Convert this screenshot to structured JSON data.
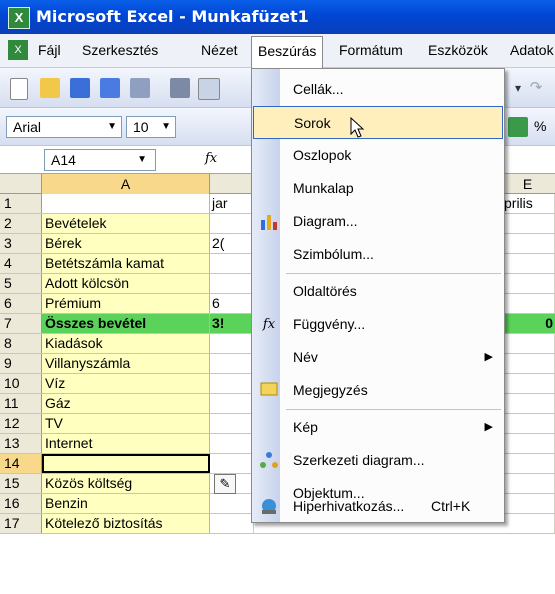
{
  "window": {
    "title": "Microsoft Excel - Munkafüzet1"
  },
  "menubar": {
    "items": [
      {
        "label": "Fájl"
      },
      {
        "label": "Szerkesztés"
      },
      {
        "label": "Nézet"
      },
      {
        "label": "Beszúrás"
      },
      {
        "label": "Formátum"
      },
      {
        "label": "Eszközök"
      },
      {
        "label": "Adatok"
      }
    ]
  },
  "format_toolbar": {
    "font": "Arial",
    "size": "10",
    "percent": "%"
  },
  "formula_bar": {
    "name_box": "A14",
    "fx": "fx"
  },
  "columns": {
    "a": "A",
    "e": "E"
  },
  "rows": [
    {
      "num": "1",
      "a": "",
      "b": "jar",
      "right": "prilis"
    },
    {
      "num": "2",
      "a": "Bevételek",
      "b": "",
      "right": ""
    },
    {
      "num": "3",
      "a": "Bérek",
      "b": "2(",
      "right": ""
    },
    {
      "num": "4",
      "a": "Betétszámla kamat",
      "b": "",
      "right": ""
    },
    {
      "num": "5",
      "a": "Adott kölcsön",
      "b": "",
      "right": ""
    },
    {
      "num": "6",
      "a": "Prémium",
      "b": "6",
      "right": ""
    },
    {
      "num": "7",
      "a": "Összes bevétel",
      "b": "3!",
      "right": "0"
    },
    {
      "num": "8",
      "a": "Kiadások",
      "b": "",
      "right": ""
    },
    {
      "num": "9",
      "a": "Villanyszámla",
      "b": "",
      "right": ""
    },
    {
      "num": "10",
      "a": "Víz",
      "b": "",
      "right": ""
    },
    {
      "num": "11",
      "a": "Gáz",
      "b": "",
      "right": ""
    },
    {
      "num": "12",
      "a": "TV",
      "b": "",
      "right": ""
    },
    {
      "num": "13",
      "a": "Internet",
      "b": "",
      "right": ""
    },
    {
      "num": "14",
      "a": "",
      "b": "",
      "right": ""
    },
    {
      "num": "15",
      "a": "Közös költség",
      "b": "",
      "right": ""
    },
    {
      "num": "16",
      "a": "Benzin",
      "b": "",
      "right": ""
    },
    {
      "num": "17",
      "a": "Kötelező biztosítás",
      "b": "",
      "right": ""
    }
  ],
  "insert_menu": {
    "items": [
      {
        "label": "Cellák...",
        "shortcut": ""
      },
      {
        "label": "Sorok",
        "shortcut": ""
      },
      {
        "label": "Oszlopok",
        "shortcut": ""
      },
      {
        "label": "Munkalap",
        "shortcut": ""
      },
      {
        "label": "Diagram...",
        "shortcut": ""
      },
      {
        "label": "Szimbólum...",
        "shortcut": ""
      },
      {
        "label": "Oldaltörés",
        "shortcut": ""
      },
      {
        "label": "Függvény...",
        "shortcut": ""
      },
      {
        "label": "Név",
        "shortcut": ""
      },
      {
        "label": "Megjegyzés",
        "shortcut": ""
      },
      {
        "label": "Kép",
        "shortcut": ""
      },
      {
        "label": "Szerkezeti diagram...",
        "shortcut": ""
      },
      {
        "label": "Objektum...",
        "shortcut": ""
      },
      {
        "label": "Hiperhivatkozás...",
        "shortcut": "Ctrl+K"
      }
    ],
    "highlighted": "Sorok"
  },
  "colors": {
    "title_bar": "#0046d5",
    "highlight": "#ffefbd",
    "label_fill": "#ffffc0",
    "total_fill": "#5bd35b"
  },
  "icons": [
    "excel-icon",
    "cursor-arrow-icon",
    "paste-options-icon"
  ]
}
